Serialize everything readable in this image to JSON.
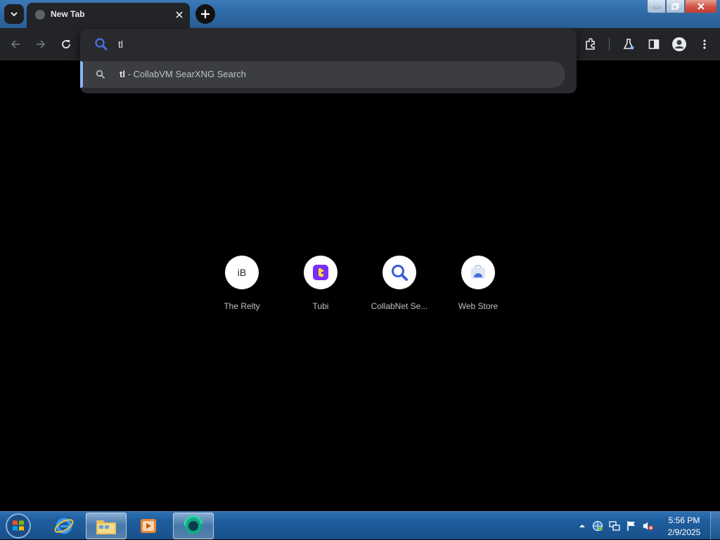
{
  "browser": {
    "tab": {
      "title": "New Tab",
      "favicon": "globe-icon"
    },
    "omnibox": {
      "value": "tl",
      "suggestion": {
        "query": "tl",
        "suffix": " - CollabVM SearXNG Search",
        "icon": "search-icon"
      }
    },
    "toolbar_icons": [
      "back-icon",
      "forward-icon",
      "reload-icon",
      "extensions-icon",
      "labs-icon",
      "side-panel-icon",
      "profile-icon",
      "menu-icon"
    ]
  },
  "shortcuts": [
    {
      "label": "The Relty",
      "icon_text": "iB"
    },
    {
      "label": "Tubi",
      "icon": "tubi-icon",
      "color": "#7b2cff"
    },
    {
      "label": "CollabNet Se...",
      "icon": "search-icon",
      "color": "#3c5bd6"
    },
    {
      "label": "Web Store",
      "icon": "web-store-icon",
      "color": "#4b6cd9"
    }
  ],
  "taskbar": {
    "clock": {
      "time": "5:56 PM",
      "date": "2/9/2025"
    },
    "apps": [
      "internet-explorer-icon",
      "file-explorer-icon",
      "media-player-icon",
      "browser-icon"
    ]
  },
  "colors": {
    "accent": "#8ab4f8",
    "titlebar": "#2f6aa8",
    "toolbar": "#222427",
    "omnibox": "#282a2d"
  }
}
